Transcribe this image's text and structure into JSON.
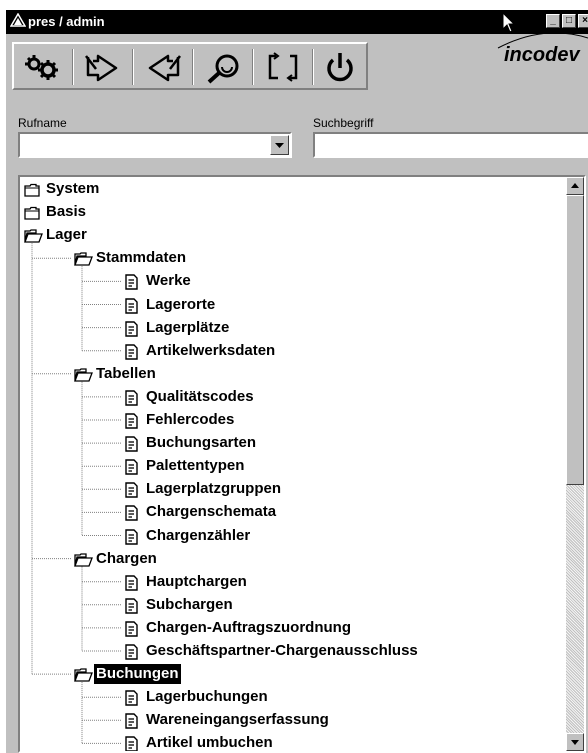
{
  "window": {
    "title": "pres / admin",
    "controls": {
      "minimize": "_",
      "maximize": "□",
      "close": "×"
    }
  },
  "brand": "incodev",
  "toolbar": {
    "buttons": [
      {
        "name": "settings",
        "icon": "gears-icon"
      },
      {
        "name": "forward",
        "icon": "forward-arrow-icon"
      },
      {
        "name": "back",
        "icon": "back-arrow-icon"
      },
      {
        "name": "search",
        "icon": "magnifier-icon"
      },
      {
        "name": "refresh",
        "icon": "refresh-icon"
      },
      {
        "name": "power",
        "icon": "power-icon"
      }
    ]
  },
  "filters": {
    "rufname_label": "Rufname",
    "rufname_value": "",
    "suchbegriff_label": "Suchbegriff",
    "suchbegriff_value": ""
  },
  "tree": {
    "nodes": [
      {
        "label": "System",
        "level": 0,
        "type": "folder",
        "open": false
      },
      {
        "label": "Basis",
        "level": 0,
        "type": "folder",
        "open": false
      },
      {
        "label": "Lager",
        "level": 0,
        "type": "folder",
        "open": true
      },
      {
        "label": "Stammdaten",
        "level": 1,
        "type": "folder",
        "open": true
      },
      {
        "label": "Werke",
        "level": 2,
        "type": "doc"
      },
      {
        "label": "Lagerorte",
        "level": 2,
        "type": "doc"
      },
      {
        "label": "Lagerplätze",
        "level": 2,
        "type": "doc"
      },
      {
        "label": "Artikelwerksdaten",
        "level": 2,
        "type": "doc"
      },
      {
        "label": "Tabellen",
        "level": 1,
        "type": "folder",
        "open": true
      },
      {
        "label": "Qualitätscodes",
        "level": 2,
        "type": "doc"
      },
      {
        "label": "Fehlercodes",
        "level": 2,
        "type": "doc"
      },
      {
        "label": "Buchungsarten",
        "level": 2,
        "type": "doc"
      },
      {
        "label": "Palettentypen",
        "level": 2,
        "type": "doc"
      },
      {
        "label": "Lagerplatzgruppen",
        "level": 2,
        "type": "doc"
      },
      {
        "label": "Chargenschemata",
        "level": 2,
        "type": "doc"
      },
      {
        "label": "Chargenzähler",
        "level": 2,
        "type": "doc"
      },
      {
        "label": "Chargen",
        "level": 1,
        "type": "folder",
        "open": true
      },
      {
        "label": "Hauptchargen",
        "level": 2,
        "type": "doc"
      },
      {
        "label": "Subchargen",
        "level": 2,
        "type": "doc"
      },
      {
        "label": "Chargen-Auftragszuordnung",
        "level": 2,
        "type": "doc"
      },
      {
        "label": "Geschäftspartner-Chargenausschluss",
        "level": 2,
        "type": "doc"
      },
      {
        "label": "Buchungen",
        "level": 1,
        "type": "folder",
        "open": true,
        "selected": true
      },
      {
        "label": "Lagerbuchungen",
        "level": 2,
        "type": "doc"
      },
      {
        "label": "Wareneingangserfassung",
        "level": 2,
        "type": "doc"
      },
      {
        "label": "Artikel umbuchen",
        "level": 2,
        "type": "doc"
      }
    ]
  },
  "colors": {
    "selection": "#000000",
    "face": "#c0c0c0",
    "titlebar": "#000000"
  }
}
